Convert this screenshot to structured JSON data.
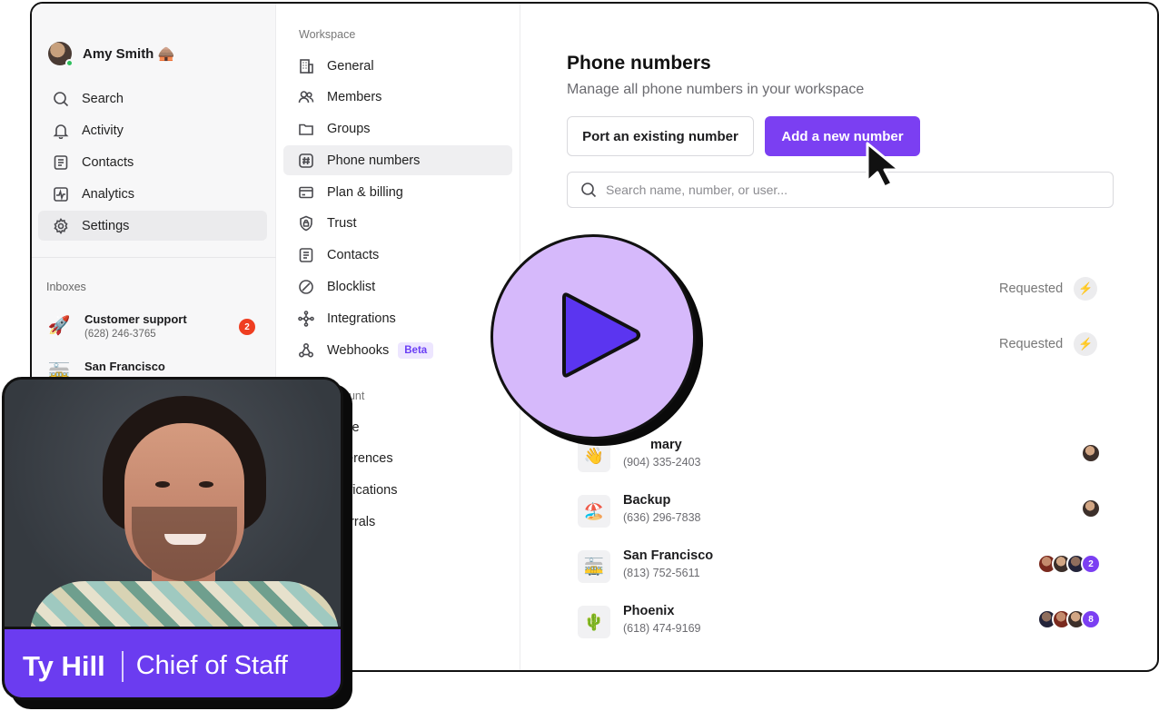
{
  "user": {
    "name": "Amy Smith",
    "emoji": "🛖"
  },
  "nav": [
    {
      "label": "Search",
      "icon": "search-icon"
    },
    {
      "label": "Activity",
      "icon": "bell-icon"
    },
    {
      "label": "Contacts",
      "icon": "contacts-icon"
    },
    {
      "label": "Analytics",
      "icon": "analytics-icon"
    },
    {
      "label": "Settings",
      "icon": "gear-icon",
      "active": true
    }
  ],
  "inboxes": {
    "heading": "Inboxes",
    "items": [
      {
        "name": "Customer support",
        "phone": "(628) 246-3765",
        "emoji": "🚀",
        "unread": "2"
      },
      {
        "name": "San Francisco",
        "emoji": "🚋"
      }
    ]
  },
  "workspace": {
    "heading": "Workspace",
    "items": [
      {
        "label": "General",
        "icon": "building-icon"
      },
      {
        "label": "Members",
        "icon": "members-icon"
      },
      {
        "label": "Groups",
        "icon": "folder-icon"
      },
      {
        "label": "Phone numbers",
        "icon": "hash-icon",
        "active": true
      },
      {
        "label": "Plan & billing",
        "icon": "card-icon"
      },
      {
        "label": "Trust",
        "icon": "shield-icon"
      },
      {
        "label": "Contacts",
        "icon": "contacts-icon"
      },
      {
        "label": "Blocklist",
        "icon": "block-icon"
      },
      {
        "label": "Integrations",
        "icon": "integrations-icon"
      },
      {
        "label": "Webhooks",
        "icon": "webhooks-icon",
        "badge": "Beta"
      }
    ]
  },
  "account": {
    "heading": "ount",
    "items": [
      "file",
      "ferences",
      "tifications",
      "errals"
    ]
  },
  "main": {
    "title": "Phone numbers",
    "subtitle": "Manage all phone numbers in your workspace",
    "port_button": "Port an existing number",
    "add_button": "Add a new number",
    "search_placeholder": "Search name, number, or user...",
    "requested": [
      {
        "status": "Requested",
        "partial": "6"
      },
      {
        "status": "Requested"
      }
    ],
    "numbers": [
      {
        "name": "mary",
        "phone": "(904) 335-2403",
        "emoji": "👋",
        "members": 1
      },
      {
        "name": "Backup",
        "phone": "(636) 296-7838",
        "emoji": "🏖️",
        "members": 1
      },
      {
        "name": "San Francisco",
        "phone": "(813) 752-5611",
        "emoji": "🚋",
        "members": 3,
        "more": "2"
      },
      {
        "name": "Phoenix",
        "phone": "(618) 474-9169",
        "emoji": "🌵",
        "members": 3,
        "more": "8"
      }
    ]
  },
  "video": {
    "name": "Ty Hill",
    "role": "Chief of Staff"
  },
  "colors": {
    "accent": "#7b3ff2",
    "play": "#d6b9fb",
    "caption": "#6b3cf0",
    "unread": "#ef3e21"
  }
}
